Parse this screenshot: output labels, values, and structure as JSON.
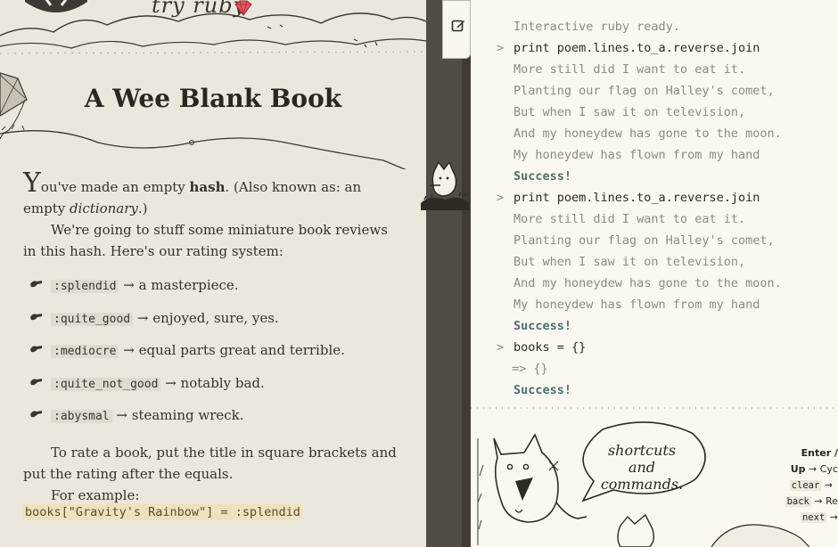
{
  "brand": {
    "title": "try ruby"
  },
  "lesson": {
    "title": "A Wee Blank Book",
    "intro_dropcap": "Y",
    "intro_rest_1": "ou've made an empty ",
    "intro_bold": "hash",
    "intro_rest_2": ". (Also known as: an empty ",
    "intro_italic": "dictionary",
    "intro_rest_3": ".)",
    "para2": "We're going to stuff some miniature book reviews in this hash. Here's our rating system:",
    "ratings": [
      {
        "symbol": ":splendid",
        "desc": "a masterpiece."
      },
      {
        "symbol": ":quite_good",
        "desc": "enjoyed, sure, yes."
      },
      {
        "symbol": ":mediocre",
        "desc": "equal parts great and terrible."
      },
      {
        "symbol": ":quite_not_good",
        "desc": "notably bad."
      },
      {
        "symbol": ":abysmal",
        "desc": "steaming wreck."
      }
    ],
    "arrow": "→",
    "para3": "To rate a book, put the title in square brackets and put the rating after the equals.",
    "para4": "For example:",
    "example_code": "books[\"Gravity's Rainbow\"] = :splendid"
  },
  "console": {
    "ready": "Interactive ruby ready.",
    "prompt_char": ">",
    "cmd1": "print poem.lines.to_a.reverse.join",
    "poem": [
      "More still did I want to eat it.",
      "Planting our flag on Halley's comet,",
      "But when I saw it on television,",
      "And my honeydew has gone to the moon.",
      "My honeydew has flown from my hand"
    ],
    "success": "Success!",
    "cmd3": "books = {}",
    "result3": "=> {}"
  },
  "help": {
    "bubble_line1": "shortcuts",
    "bubble_line2": "and",
    "bubble_line3": "commands.",
    "enter_label": "Enter /",
    "up_key": "Up",
    "up_desc": "Cyc",
    "clear_key": "clear",
    "back_key": "back",
    "back_desc": "Re",
    "next_key": "next",
    "arrow": "→"
  },
  "colors": {
    "success": "#4f6f6c",
    "code_highlight": "#efe1bf",
    "spine": "#514c45"
  }
}
